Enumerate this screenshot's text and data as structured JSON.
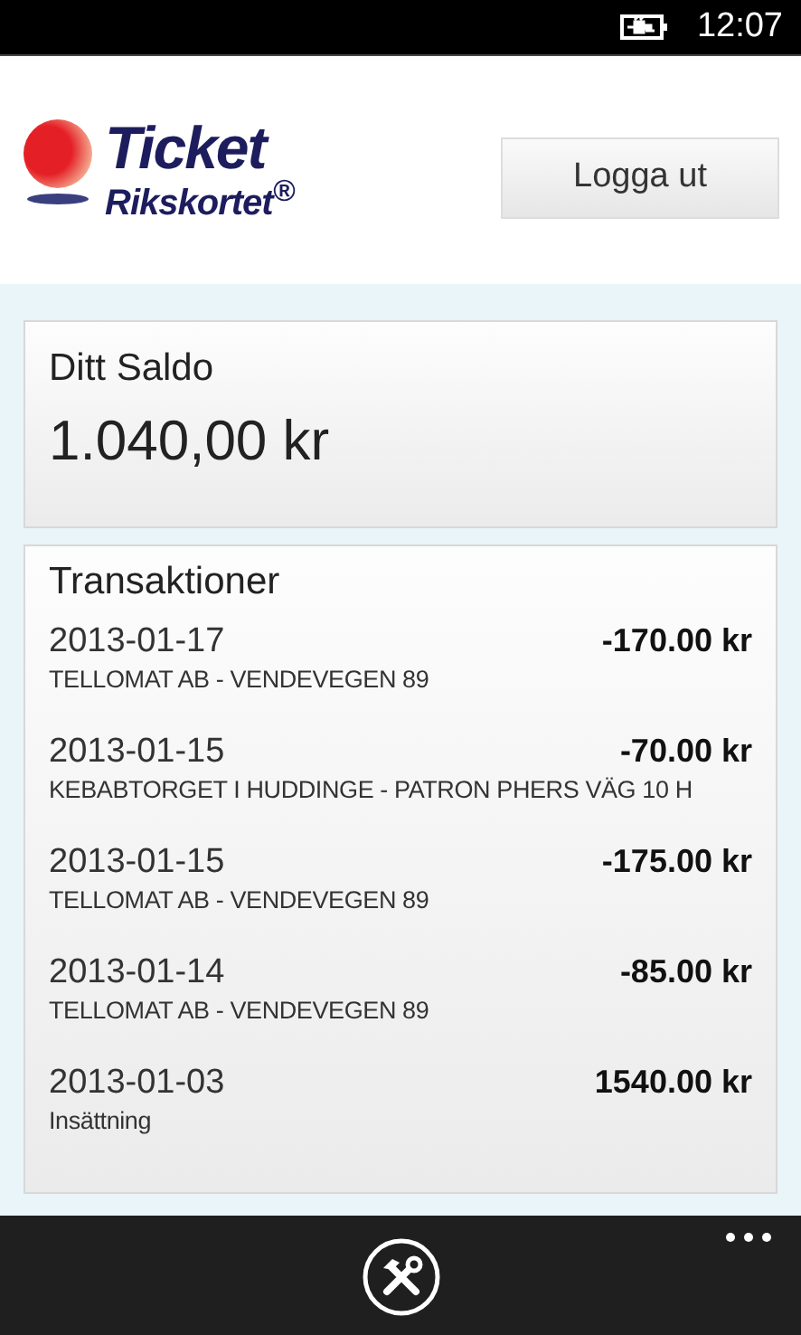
{
  "status_bar": {
    "time": "12:07"
  },
  "header": {
    "logo": {
      "line1": "Ticket",
      "line2": "Rikskortet$^{®}$"
    },
    "logout_button": "Logga ut"
  },
  "balance": {
    "title": "Ditt Saldo",
    "amount": "1.040,00 kr"
  },
  "transactions": {
    "title": "Transaktioner",
    "rows": [
      {
        "date": "2013-01-17",
        "amount": "-170.00 kr",
        "description": "TELLOMAT AB - VENDEVEGEN 89"
      },
      {
        "date": "2013-01-15",
        "amount": "-70.00 kr",
        "description": "KEBABTORGET I HUDDINGE - PATRON PHERS VÄG 10  H"
      },
      {
        "date": "2013-01-15",
        "amount": "-175.00 kr",
        "description": "TELLOMAT AB - VENDEVEGEN 89"
      },
      {
        "date": "2013-01-14",
        "amount": "-85.00 kr",
        "description": "TELLOMAT AB - VENDEVEGEN 89"
      },
      {
        "date": "2013-01-03",
        "amount": "1540.00 kr",
        "description": "Insättning"
      }
    ]
  }
}
